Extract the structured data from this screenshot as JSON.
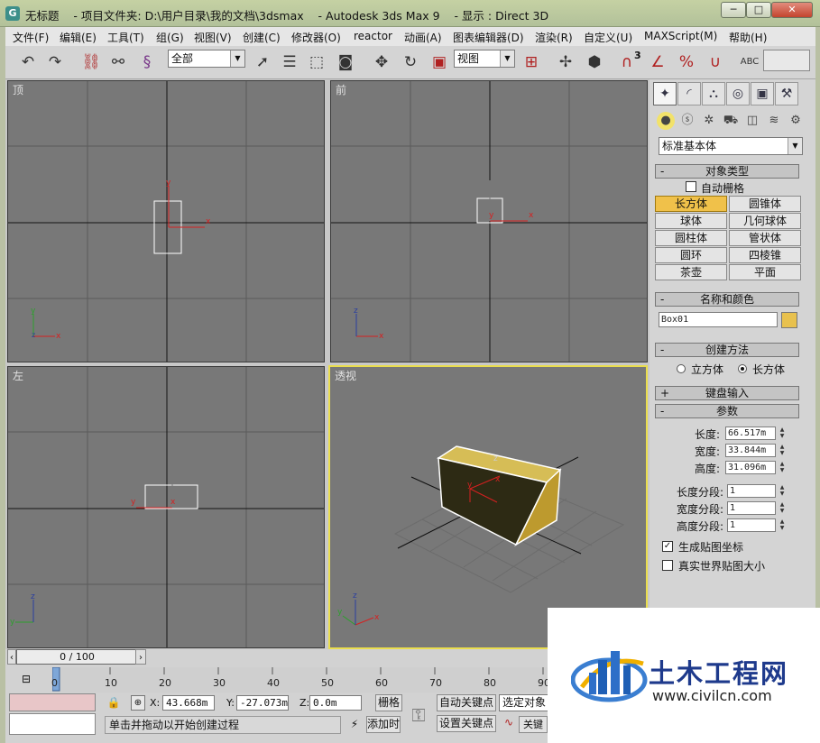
{
  "window": {
    "title": "无标题    - 项目文件夹: D:\\用户目录\\我的文档\\3dsmax    - Autodesk 3ds Max 9    - 显示 : Direct 3D",
    "app_icon": "G",
    "minimize": "─",
    "maximize": "□",
    "close": "✕"
  },
  "menu": [
    "文件(F)",
    "编辑(E)",
    "工具(T)",
    "组(G)",
    "视图(V)",
    "创建(C)",
    "修改器(O)",
    "reactor",
    "动画(A)",
    "图表编辑器(D)",
    "渲染(R)",
    "自定义(U)",
    "MAXScript(M)",
    "帮助(H)"
  ],
  "toolbar": {
    "selection_filter": "全部",
    "reference_coord": "视图",
    "icons": [
      "undo-icon",
      "redo-icon",
      "select-link-icon",
      "unlink-icon",
      "bind-spacewarp-icon",
      "select-object-icon",
      "select-by-name-icon",
      "rectangular-region-icon",
      "window-crossing-icon",
      "move-icon",
      "rotate-icon",
      "scale-icon",
      "pivot-icon",
      "mirror-icon",
      "align-icon",
      "snap-3d-icon",
      "angle-snap-icon",
      "percent-snap-icon",
      "spinner-snap-icon",
      "named-selection-icon"
    ],
    "snap_label": "3"
  },
  "viewports": {
    "top": {
      "label": "顶"
    },
    "front": {
      "label": "前"
    },
    "left": {
      "label": "左"
    },
    "perspective": {
      "label": "透视"
    }
  },
  "command_panel": {
    "dropdown": "标准基本体",
    "object_type": {
      "title": "对象类型",
      "autogrid": "自动栅格",
      "buttons": [
        "长方体",
        "圆锥体",
        "球体",
        "几何球体",
        "圆柱体",
        "管状体",
        "圆环",
        "四棱锥",
        "茶壶",
        "平面"
      ],
      "active": "长方体"
    },
    "name_color": {
      "title": "名称和颜色",
      "name": "Box01",
      "color": "#e8c14e"
    },
    "creation_method": {
      "title": "创建方法",
      "cube": "立方体",
      "box": "长方体"
    },
    "keyboard_entry": {
      "title": "键盘输入"
    },
    "parameters": {
      "title": "参数",
      "length_label": "长度:",
      "length": "66.517m",
      "width_label": "宽度:",
      "width": "33.844m",
      "height_label": "高度:",
      "height": "31.096m",
      "length_segs_label": "长度分段:",
      "length_segs": "1",
      "width_segs_label": "宽度分段:",
      "width_segs": "1",
      "height_segs_label": "高度分段:",
      "height_segs": "1",
      "gen_mapping": "生成贴图坐标",
      "real_world": "真实世界贴图大小"
    }
  },
  "timeline": {
    "frame_display": "0 / 100",
    "ticks": [
      "0",
      "10",
      "20",
      "30",
      "40",
      "50",
      "60",
      "70",
      "80",
      "90"
    ]
  },
  "status": {
    "x_label": "X:",
    "x": "43.668m",
    "y_label": "Y:",
    "y": "-27.073m",
    "z_label": "Z:",
    "z": "0.0m",
    "grid": "栅格",
    "prompt": "单击并拖动以开始创建过程",
    "add_time_tag": "添加时",
    "auto_key": "自动关键点",
    "set_key": "设置关键点",
    "selected": "选定对象",
    "key_filters": "关键点"
  },
  "watermark": {
    "brand": "土木工程网",
    "url": "www.civilcn.com"
  },
  "colors": {
    "active_viewport": "#e9dd4e",
    "box": "#c9a93a",
    "axis_x": "#d62020",
    "axis_y": "#d62020",
    "axis_z": "#2a3ea0"
  }
}
